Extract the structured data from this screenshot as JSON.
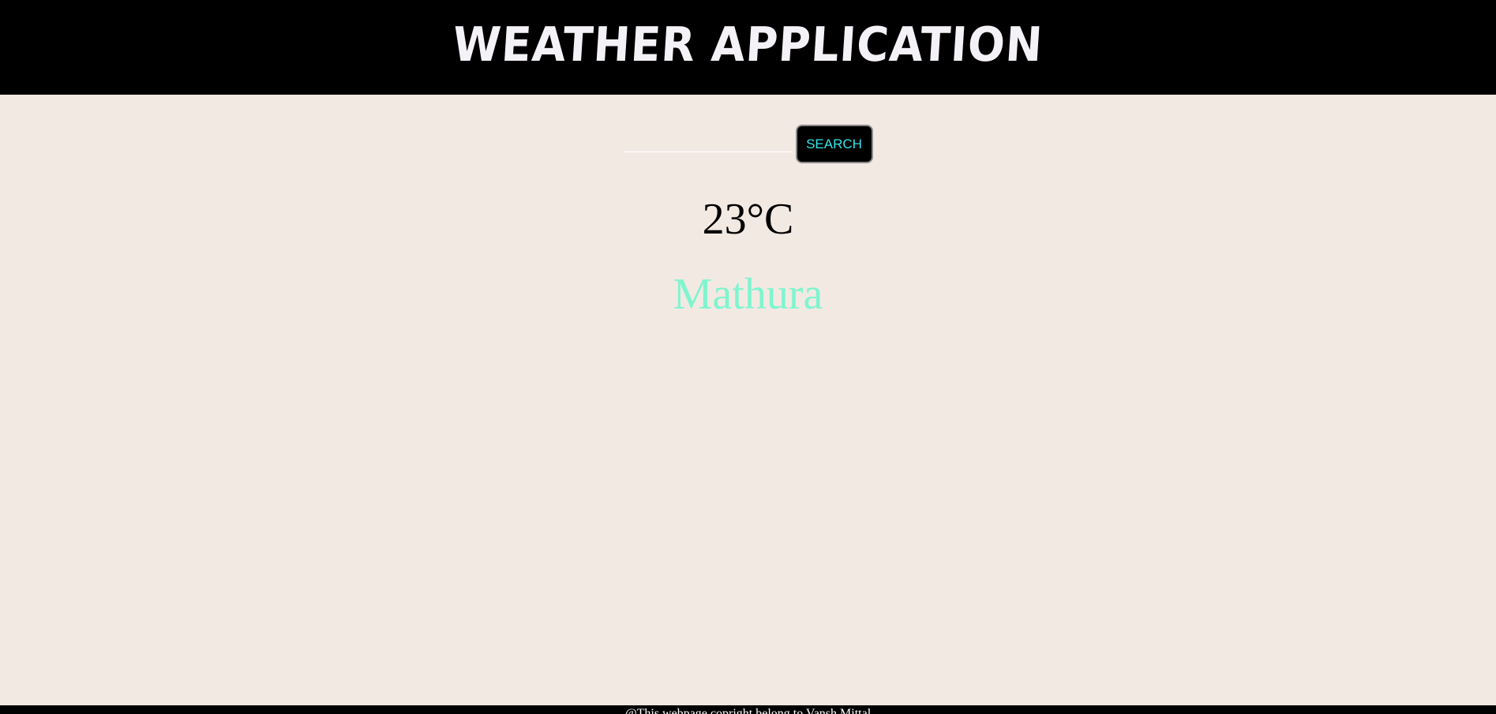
{
  "header": {
    "title": "WEATHER APPLICATION"
  },
  "search": {
    "value": "",
    "placeholder": "",
    "button_label": "SEARCH"
  },
  "weather": {
    "temperature": "23°C",
    "city": "Mathura"
  },
  "footer": {
    "text": "@This webpage copright belong to Vansh Mittal"
  },
  "colors": {
    "background": "#f3e9e3",
    "header_bg": "#000000",
    "header_text": "#f4f2f6",
    "button_text": "#35e6ea",
    "city_text": "#7ff5cf",
    "temperature_text": "#000000"
  }
}
